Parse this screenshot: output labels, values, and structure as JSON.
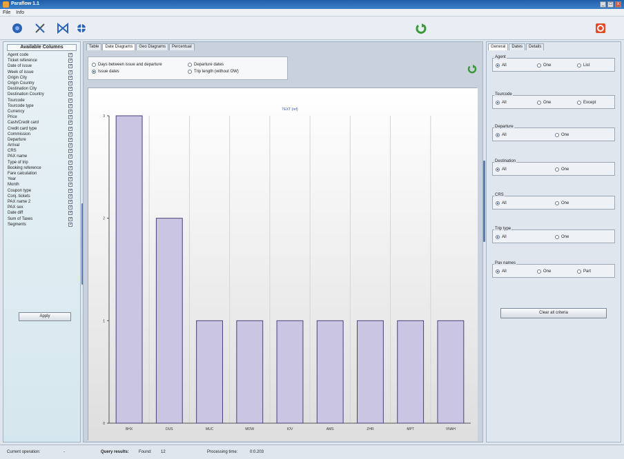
{
  "window": {
    "title": "Paraflow 1.1"
  },
  "menu": [
    "File",
    "Info"
  ],
  "toolbar": {
    "icons": [
      "globe-icon",
      "tools-icon",
      "bowtie-icon",
      "network-icon",
      "refresh-icon",
      "exit-icon"
    ],
    "colors": {
      "blue": "#2d63b5",
      "green": "#3a9a3a",
      "red": "#e24a2a"
    }
  },
  "left_panel": {
    "header": "Available Columns",
    "columns": [
      "Agent code",
      "Ticket reference",
      "Date of issue",
      "Week of issue",
      "Origin City",
      "Origin Country",
      "Destination City",
      "Destination Country",
      "Tourcode",
      "Tourcode type",
      "Currency",
      "Price",
      "Cash/Credit card",
      "Credit card type",
      "Commission",
      "Departure",
      "Arrival",
      "CRS",
      "PAX name",
      "Type of trip",
      "Booking reference",
      "Fare calculation",
      "Year",
      "Month",
      "Coupon type",
      "Conj. tickets",
      "PAX name 2",
      "PAX sex",
      "Date diff",
      "Sum of Taxes",
      "Segments"
    ],
    "check_mark": "✓",
    "apply_label": "Apply"
  },
  "center": {
    "tabs": [
      "Table",
      "Date Diagrams",
      "Geo Diagrams",
      "Percentual"
    ],
    "active_tab": 1,
    "options": {
      "days_between": "Days between issue and departure",
      "departure_dates": "Departure dates",
      "issue_dates": "Issue dates",
      "trip_length": "Trip length (without OW)"
    }
  },
  "chart_data": {
    "type": "bar",
    "title": "TEXT (ref)",
    "categories": [
      "BHX",
      "DUS",
      "MUC",
      "MOW",
      "IOV",
      "AMS",
      "ZHR",
      "MPT",
      "VNAH"
    ],
    "values": [
      3,
      2,
      1,
      1,
      1,
      1,
      1,
      1,
      1
    ],
    "ylim": [
      0,
      3
    ],
    "yticks": [
      "0",
      "1",
      "2",
      "3"
    ],
    "bar_color": "#c9c5e3",
    "bar_stroke": "#4a3f7a",
    "grid": true
  },
  "right_panel": {
    "tabs": [
      "General",
      "Dates",
      "Details"
    ],
    "groups": [
      {
        "legend": "Agent",
        "options": [
          "All",
          "One",
          "List"
        ]
      },
      {
        "legend": "Tourcode",
        "options": [
          "All",
          "One",
          "Except"
        ]
      },
      {
        "legend": "Departure",
        "options": [
          "All",
          "One"
        ]
      },
      {
        "legend": "Destination",
        "options": [
          "All",
          "One"
        ]
      },
      {
        "legend": "CRS",
        "options": [
          "All",
          "One"
        ]
      },
      {
        "legend": "Trip type",
        "options": [
          "All",
          "One"
        ]
      },
      {
        "legend": "Pax names",
        "options": [
          "All",
          "One",
          "Part"
        ]
      }
    ],
    "clear_label": "Clear all criteria"
  },
  "status": {
    "current_label": "Current operation:",
    "current_value": "-",
    "query_label": "Query results:",
    "found_label": "Found:",
    "found_value": "12",
    "proc_label": "Processing time:",
    "proc_value": "0:0.203"
  }
}
